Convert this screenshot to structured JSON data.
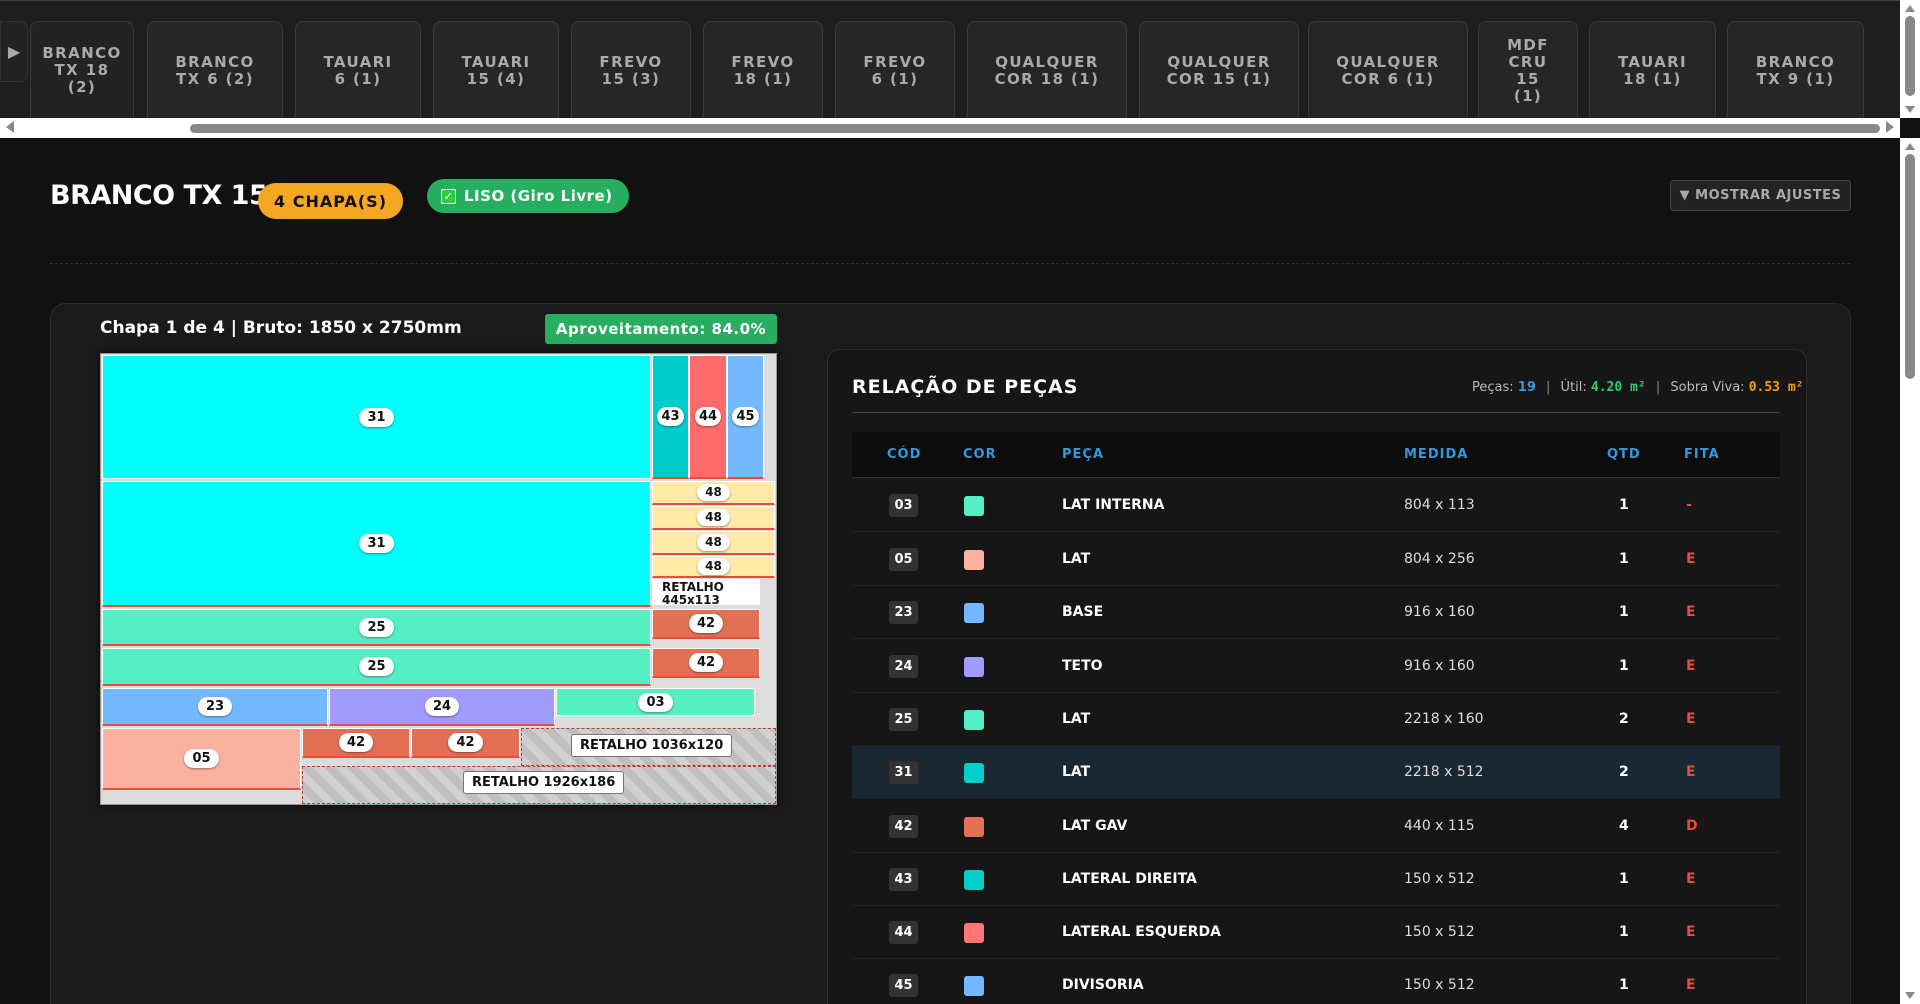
{
  "tabs": [
    {
      "label": "BRANCO\nTX 18\n(2)"
    },
    {
      "label": "BRANCO\nTX 6 (2)"
    },
    {
      "label": "TAUARI\n6 (1)"
    },
    {
      "label": "TAUARI\n15 (4)"
    },
    {
      "label": "FREVO\n15 (3)"
    },
    {
      "label": "FREVO\n18 (1)"
    },
    {
      "label": "FREVO\n6 (1)"
    },
    {
      "label": "QUALQUER\nCOR 18 (1)"
    },
    {
      "label": "QUALQUER\nCOR 15 (1)"
    },
    {
      "label": "QUALQUER\nCOR 6 (1)"
    },
    {
      "label": "MDF\nCRU\n15\n(1)"
    },
    {
      "label": "TAUARI\n18 (1)"
    },
    {
      "label": "BRANCO\nTX 9 (1)"
    }
  ],
  "header": {
    "title": "BRANCO TX 15",
    "chapas_badge": "4 CHAPA(S)",
    "liso_badge": "LISO (Giro Livre)",
    "ajustes_button": "▼ MOSTRAR AJUSTES"
  },
  "sheet": {
    "info": "Chapa 1 de 4 | Bruto: 1850 x 2750mm",
    "aproveitamento": "Aproveitamento: 84.0%",
    "pieces": [
      {
        "code": "31",
        "color": "#00ffff"
      },
      {
        "code": "43",
        "color": "#00cccc"
      },
      {
        "code": "44",
        "color": "#ff6b6b"
      },
      {
        "code": "45",
        "color": "#74b9ff"
      },
      {
        "code": "31",
        "color": "#00ffff"
      },
      {
        "code": "48",
        "color": "#ffeaa7"
      },
      {
        "code": "48",
        "color": "#ffeaa7"
      },
      {
        "code": "48",
        "color": "#ffeaa7"
      },
      {
        "code": "48",
        "color": "#ffeaa7"
      },
      {
        "code": "25",
        "color": "#55efc4"
      },
      {
        "code": "42",
        "color": "#e17055"
      },
      {
        "code": "25",
        "color": "#55efc4"
      },
      {
        "code": "42",
        "color": "#e17055"
      },
      {
        "code": "23",
        "color": "#74b9ff"
      },
      {
        "code": "24",
        "color": "#a29bfe"
      },
      {
        "code": "03",
        "color": "#55efc4"
      },
      {
        "code": "05",
        "color": "#fab1a0"
      },
      {
        "code": "42",
        "color": "#e17055"
      },
      {
        "code": "42",
        "color": "#e17055"
      }
    ],
    "scraps": [
      {
        "label": "RETALHO\n445x113"
      },
      {
        "label": "RETALHO 1036x120"
      },
      {
        "label": "RETALHO 1926x186"
      }
    ]
  },
  "pieces_table": {
    "title": "RELAÇÃO DE PEÇAS",
    "summary": {
      "pecas_label": "Peças:",
      "pecas_value": "19",
      "util_label": "Útil:",
      "util_value": "4.20 m²",
      "sobra_label": "Sobra Viva:",
      "sobra_value": "0.53 m²"
    },
    "columns": [
      "CÓD",
      "COR",
      "PEÇA",
      "MEDIDA",
      "QTD",
      "FITA"
    ],
    "rows": [
      {
        "cod": "03",
        "color": "#55efc4",
        "peca": "LAT INTERNA",
        "medida": "804 x 113",
        "qtd": "1",
        "fita": "-"
      },
      {
        "cod": "05",
        "color": "#fab1a0",
        "peca": "LAT",
        "medida": "804 x 256",
        "qtd": "1",
        "fita": "E"
      },
      {
        "cod": "23",
        "color": "#74b9ff",
        "peca": "BASE",
        "medida": "916 x 160",
        "qtd": "1",
        "fita": "E"
      },
      {
        "cod": "24",
        "color": "#a29bfe",
        "peca": "TETO",
        "medida": "916 x 160",
        "qtd": "1",
        "fita": "E"
      },
      {
        "cod": "25",
        "color": "#55efc4",
        "peca": "LAT",
        "medida": "2218 x 160",
        "qtd": "2",
        "fita": "E"
      },
      {
        "cod": "31",
        "color": "#00cec9",
        "peca": "LAT",
        "medida": "2218 x 512",
        "qtd": "2",
        "fita": "E"
      },
      {
        "cod": "42",
        "color": "#e17055",
        "peca": "LAT GAV",
        "medida": "440 x 115",
        "qtd": "4",
        "fita": "D"
      },
      {
        "cod": "43",
        "color": "#00cec9",
        "peca": "LATERAL DIREITA",
        "medida": "150 x 512",
        "qtd": "1",
        "fita": "E"
      },
      {
        "cod": "44",
        "color": "#ff7675",
        "peca": "LATERAL ESQUERDA",
        "medida": "150 x 512",
        "qtd": "1",
        "fita": "E"
      },
      {
        "cod": "45",
        "color": "#74b9ff",
        "peca": "DIVISORIA",
        "medida": "150 x 512",
        "qtd": "1",
        "fita": "E"
      }
    ]
  }
}
